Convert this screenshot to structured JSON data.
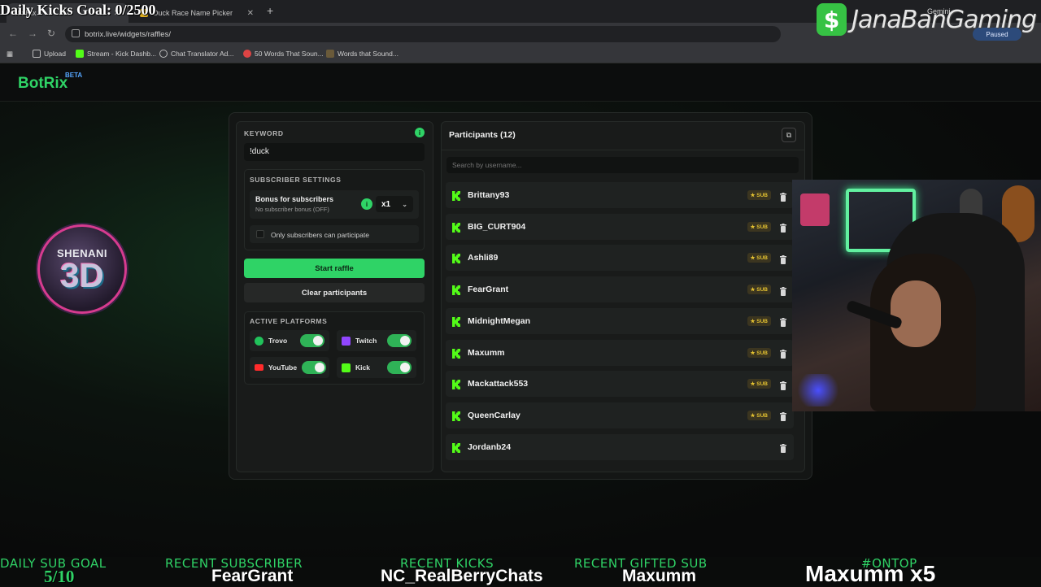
{
  "browser": {
    "tabs": [
      {
        "title": "BotRix"
      },
      {
        "title": "Duck Race Name Picker"
      }
    ],
    "url": "botrix.live/widgets/raffles/",
    "bookmarks": [
      {
        "label": "Upload"
      },
      {
        "label": "Stream - Kick Dashb..."
      },
      {
        "label": "Chat Translator Ad..."
      },
      {
        "label": "50 Words That Soun..."
      },
      {
        "label": "Words that Sound..."
      }
    ],
    "profile_label": "Gemini",
    "paused_label": "Paused"
  },
  "overlay": {
    "goal_text": "Daily Kicks Goal: 0/2500",
    "brand_icon": "$",
    "brand_text": "JanaBanGaming"
  },
  "app": {
    "name": "BotRix",
    "beta": "BETA",
    "badge": {
      "top": "SHENANI",
      "main": "3D"
    }
  },
  "raffle": {
    "keyword_label": "KEYWORD",
    "keyword_value": "!duck",
    "subscriber_settings_label": "SUBSCRIBER SETTINGS",
    "bonus_title": "Bonus for subscribers",
    "bonus_status": "No subscriber bonus (OFF)",
    "multiplier": "x1",
    "only_subs_label": "Only subscribers can participate",
    "start_label": "Start raffle",
    "clear_label": "Clear participants",
    "platforms_label": "ACTIVE PLATFORMS",
    "platforms": [
      {
        "name": "Trovo",
        "enabled": true,
        "color": "#21c35b"
      },
      {
        "name": "Twitch",
        "enabled": true,
        "color": "#9146ff"
      },
      {
        "name": "YouTube",
        "enabled": true,
        "color": "#ff2b2b"
      },
      {
        "name": "Kick",
        "enabled": true,
        "color": "#53fc18"
      }
    ]
  },
  "participants": {
    "title": "Participants (12)",
    "search_placeholder": "Search by username...",
    "sub_label": "SUB",
    "rows": [
      {
        "name": "Brittany93",
        "sub": true
      },
      {
        "name": "BIG_CURT904",
        "sub": true
      },
      {
        "name": "Ashli89",
        "sub": true
      },
      {
        "name": "FearGrant",
        "sub": true
      },
      {
        "name": "MidnightMegan",
        "sub": true
      },
      {
        "name": "Maxumm",
        "sub": true
      },
      {
        "name": "Mackattack553",
        "sub": true
      },
      {
        "name": "QueenCarlay",
        "sub": true
      },
      {
        "name": "Jordanb24",
        "sub": false
      }
    ]
  },
  "ticker": {
    "items": [
      {
        "label": "DAILY SUB GOAL",
        "value": "5/10"
      },
      {
        "label": "RECENT SUBSCRIBER",
        "value": "FearGrant"
      },
      {
        "label": "RECENT KICKS",
        "value": "NC_RealBerryChats"
      },
      {
        "label": "RECENT GIFTED SUB",
        "value": "Maxumm"
      },
      {
        "label": "#ONTOP",
        "value": "Maxumm x5"
      }
    ]
  },
  "colors": {
    "accent": "#2fd366",
    "sub_badge": "#e2c030",
    "panel_bg": "#141615"
  }
}
